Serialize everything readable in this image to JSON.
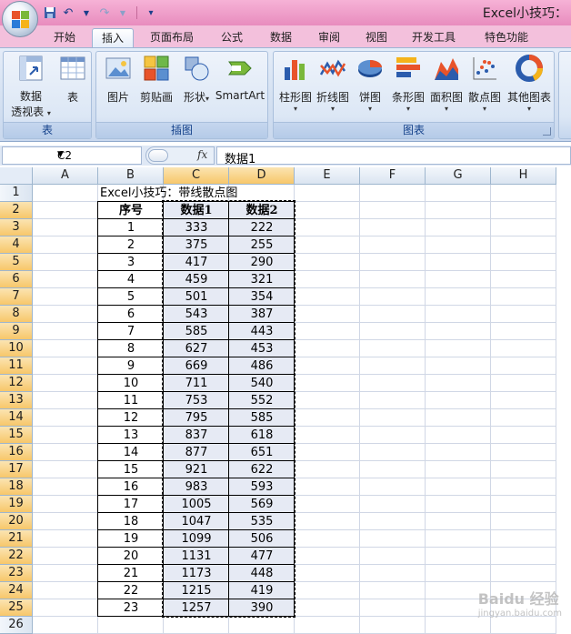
{
  "window": {
    "title": "Excel小技巧："
  },
  "tabs": [
    "开始",
    "插入",
    "页面布局",
    "公式",
    "数据",
    "审阅",
    "视图",
    "开发工具",
    "特色功能"
  ],
  "active_tab": "插入",
  "ribbon": {
    "groups": [
      {
        "label": "表",
        "buttons": [
          {
            "label": "数据",
            "label2": "透视表",
            "icon": "pivot-table-icon"
          },
          {
            "label": "表",
            "icon": "table-icon"
          }
        ]
      },
      {
        "label": "插图",
        "buttons": [
          {
            "label": "图片",
            "icon": "picture-icon"
          },
          {
            "label": "剪贴画",
            "icon": "clipart-icon"
          },
          {
            "label": "形状",
            "icon": "shapes-icon"
          },
          {
            "label": "SmartArt",
            "icon": "smartart-icon"
          }
        ]
      },
      {
        "label": "图表",
        "buttons": [
          {
            "label": "柱形图",
            "icon": "column-chart-icon"
          },
          {
            "label": "折线图",
            "icon": "line-chart-icon"
          },
          {
            "label": "饼图",
            "icon": "pie-chart-icon"
          },
          {
            "label": "条形图",
            "icon": "bar-chart-icon"
          },
          {
            "label": "面积图",
            "icon": "area-chart-icon"
          },
          {
            "label": "散点图",
            "icon": "scatter-chart-icon"
          },
          {
            "label": "其他图表",
            "icon": "other-charts-icon"
          }
        ]
      }
    ]
  },
  "formula_bar": {
    "name_box": "C2",
    "fx": "fx",
    "content": "数据1"
  },
  "columns": [
    "A",
    "B",
    "C",
    "D",
    "E",
    "F",
    "G",
    "H"
  ],
  "rows": [
    "1",
    "2",
    "3",
    "4",
    "5",
    "6",
    "7",
    "8",
    "9",
    "10",
    "11",
    "12",
    "13",
    "14",
    "15",
    "16",
    "17",
    "18",
    "19",
    "20",
    "21",
    "22",
    "23",
    "24",
    "25",
    "26"
  ],
  "sheet": {
    "title_cell": "Excel小技巧：带线散点图",
    "headers": [
      "序号",
      "数据1",
      "数据2"
    ],
    "data": [
      [
        "1",
        "333",
        "222"
      ],
      [
        "2",
        "375",
        "255"
      ],
      [
        "3",
        "417",
        "290"
      ],
      [
        "4",
        "459",
        "321"
      ],
      [
        "5",
        "501",
        "354"
      ],
      [
        "6",
        "543",
        "387"
      ],
      [
        "7",
        "585",
        "443"
      ],
      [
        "8",
        "627",
        "453"
      ],
      [
        "9",
        "669",
        "486"
      ],
      [
        "10",
        "711",
        "540"
      ],
      [
        "11",
        "753",
        "552"
      ],
      [
        "12",
        "795",
        "585"
      ],
      [
        "13",
        "837",
        "618"
      ],
      [
        "14",
        "877",
        "651"
      ],
      [
        "15",
        "921",
        "622"
      ],
      [
        "16",
        "983",
        "593"
      ],
      [
        "17",
        "1005",
        "569"
      ],
      [
        "18",
        "1047",
        "535"
      ],
      [
        "19",
        "1099",
        "506"
      ],
      [
        "20",
        "1131",
        "477"
      ],
      [
        "21",
        "1173",
        "448"
      ],
      [
        "22",
        "1215",
        "419"
      ],
      [
        "23",
        "1257",
        "390"
      ]
    ]
  },
  "watermark": {
    "brand": "Baidu 经验",
    "url": "jingyan.baidu.com"
  }
}
